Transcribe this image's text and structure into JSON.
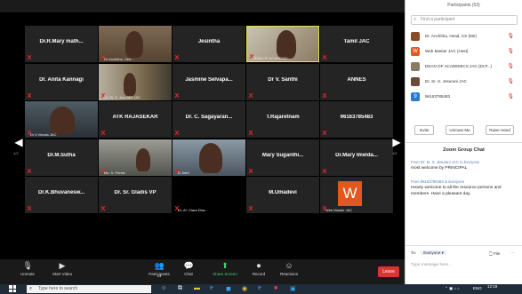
{
  "grid": [
    {
      "name": "Dr.R.Mary math...",
      "video": "",
      "caption": "",
      "highlight": false
    },
    {
      "name": "",
      "video": "v1",
      "caption": "Dr Anchitha, Hea...",
      "highlight": false
    },
    {
      "name": "Jesintha",
      "video": "",
      "caption": "",
      "highlight": false
    },
    {
      "name": "",
      "video": "v2",
      "caption": "DEAN OF ACADEMIC...",
      "highlight": true
    },
    {
      "name": "Tamil JAC",
      "video": "",
      "caption": "",
      "highlight": false
    },
    {
      "name": "Dr. Anita Kannagi",
      "video": "",
      "caption": "",
      "highlight": false
    },
    {
      "name": "",
      "video": "v3",
      "caption": "Dr. Sr. S. Jesurani JAC",
      "highlight": false
    },
    {
      "name": "Jasmine Selvapa...",
      "video": "",
      "caption": "",
      "highlight": false
    },
    {
      "name": "Dr V. Santhi",
      "video": "",
      "caption": "",
      "highlight": false
    },
    {
      "name": "ANNES",
      "video": "",
      "caption": "",
      "highlight": false
    },
    {
      "name": "",
      "video": "v4",
      "caption": "Dr.V.Vimala JAC",
      "highlight": false
    },
    {
      "name": "ATK RAJASEKAR",
      "video": "",
      "caption": "",
      "highlight": false
    },
    {
      "name": "Dr. C. Sagayaran...",
      "video": "",
      "caption": "",
      "highlight": false
    },
    {
      "name": "T.Rajaretnam",
      "video": "",
      "caption": "",
      "highlight": false
    },
    {
      "name": "96163785483",
      "video": "",
      "caption": "",
      "highlight": false
    },
    {
      "name": "Dr.M.Sutha",
      "video": "",
      "caption": "",
      "highlight": false
    },
    {
      "name": "",
      "video": "v5",
      "caption": "Ms. S. Persis",
      "highlight": false
    },
    {
      "name": "",
      "video": "v6",
      "caption": "D.Jothi",
      "highlight": false
    },
    {
      "name": "Mary Suganthi...",
      "video": "",
      "caption": "",
      "highlight": false
    },
    {
      "name": "Dr.Mary Imelda...",
      "video": "",
      "caption": "",
      "highlight": false
    },
    {
      "name": "Dr.K.Bhuvanesw...",
      "video": "",
      "caption": "",
      "highlight": false
    },
    {
      "name": "Dr. Sr. Gladis VP",
      "video": "",
      "caption": "",
      "highlight": false
    },
    {
      "name": "",
      "video": "black",
      "caption": "Dr. A+ Clara Dha...",
      "highlight": false
    },
    {
      "name": "M.Umadevi",
      "video": "",
      "caption": "",
      "highlight": false
    },
    {
      "name": "",
      "video": "wlogo",
      "caption": "Web Master JAC",
      "highlight": false
    }
  ],
  "page_left": "1/2",
  "page_right": "1/2",
  "toolbar": {
    "unmute": "Unmute",
    "start_video": "Start Video",
    "participants": "Participants",
    "participants_count": "53",
    "chat": "Chat",
    "share": "Share Screen",
    "record": "Record",
    "reactions": "Reactions",
    "leave": "Leave"
  },
  "taskbar": {
    "search_placeholder": "Type here to search",
    "lang": "ENG",
    "time": "12:19"
  },
  "panel": {
    "title": "Participants (53)",
    "search_placeholder": "Find a participant",
    "participants": [
      {
        "name": "Dr. Anchitha, Head, CS (Me)",
        "avatar": "#8a4a2a"
      },
      {
        "name": "Web Master JAC (Host)",
        "avatar": "#e2561f",
        "letter": "W"
      },
      {
        "name": "DEAN OF ACADEMICS JAC (Dr.P...)",
        "avatar": "#8a7a62"
      },
      {
        "name": "Dr. Sr. S. Jesurani JAC",
        "avatar": "#6b4a3a"
      },
      {
        "name": "96163785483",
        "avatar": "#2a7ad0",
        "letter": "9"
      }
    ],
    "invite": "Invite",
    "unmute_me": "Unmute Me",
    "raise_hand": "Raise Hand",
    "chat_title": "Zoom Group Chat",
    "messages": [
      {
        "meta": "From Dr. Sr. S. Jesurani JAC to Everyone",
        "text": "most welcome by PRINCIPAL"
      },
      {
        "meta": "From 96163785483 to Everyone",
        "text": "Hearty welcome to all the resource persons and members. Have a pleasant day."
      }
    ],
    "to_label": "To:",
    "to_value": "Everyone",
    "file": "File",
    "type_message": "Type message here..."
  }
}
